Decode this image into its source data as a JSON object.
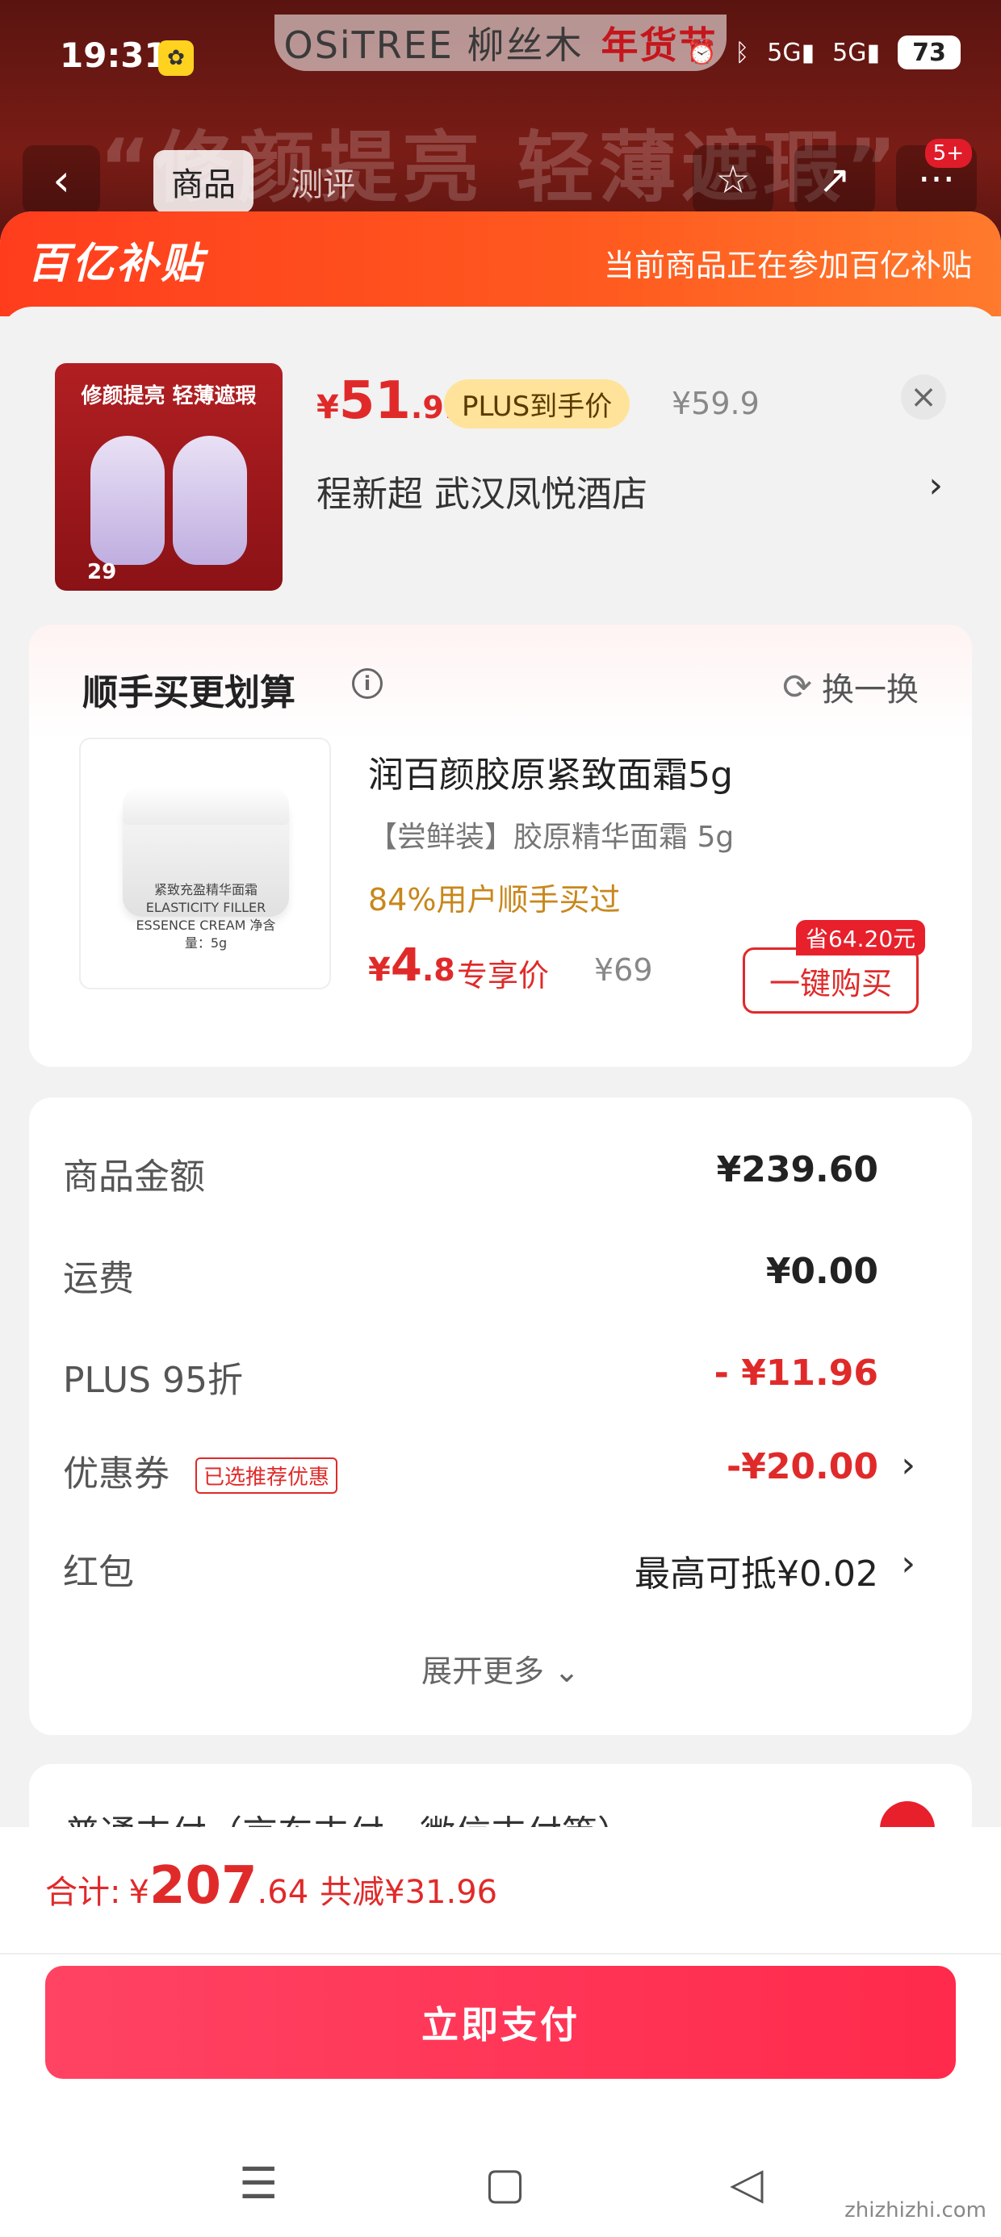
{
  "status": {
    "time": "19:31",
    "battery": "73",
    "network1": "5G",
    "network2": "5G"
  },
  "background": {
    "brand": "OSiTREE 柳丝木",
    "festival": "年货节",
    "slogan": "“修颜提亮 轻薄遮瑕”"
  },
  "nav": {
    "tabs": [
      "商品",
      "测评"
    ],
    "badge": "5+"
  },
  "subsidy": {
    "logo": "百亿补贴",
    "note": "当前商品正在参加百亿补贴"
  },
  "product": {
    "image_slogan": "修颜提亮 轻薄遮瑕",
    "image_price": "29",
    "price_cur": "¥",
    "price_int": "51",
    "price_dec": ".91",
    "plus_label": "PLUS到手价",
    "original_price": "¥59.9",
    "address": "程新超  武汉凤悦酒店"
  },
  "buy_more": {
    "title": "顺手买更划算",
    "swap": "换一换",
    "name": "润百颜胶原紧致面霜5g",
    "subtitle": "【尝鲜装】胶原精华面霜 5g",
    "rate": "84%用户顺手买过",
    "price_cur": "¥",
    "price_int": "4",
    "price_dec": ".8",
    "exclusive": "专享价",
    "original": "¥69",
    "save_tag": "省64.20元",
    "buy_button": "一键购买",
    "jar_text": "紧致充盈精华面霜 ELASTICITY FILLER ESSENCE CREAM 净含量：5g"
  },
  "summary": {
    "goods_label": "商品金额",
    "goods_value": "¥239.60",
    "shipping_label": "运费",
    "shipping_value": "¥0.00",
    "plus_label": "PLUS 95折",
    "plus_value": "- ¥11.96",
    "coupon_label": "优惠券",
    "coupon_tag": "已选推荐优惠",
    "coupon_value": "-¥20.00",
    "redpacket_label": "红包",
    "redpacket_value": "最高可抵¥0.02",
    "expand": "展开更多 ⌄"
  },
  "payment_method": {
    "label": "普通支付（京东支付、微信支付等）"
  },
  "bottom": {
    "total_label": "合计:",
    "total_cur": "¥",
    "total_int": "207",
    "total_dec": ".64",
    "total_saved": "共减¥31.96",
    "pay_button": "立即支付"
  },
  "watermark": "zhizhizhi.com",
  "colors": {
    "accent": "#e02a2a",
    "pay_button": "#ff2a4c",
    "banner": "#ff4a1f"
  }
}
